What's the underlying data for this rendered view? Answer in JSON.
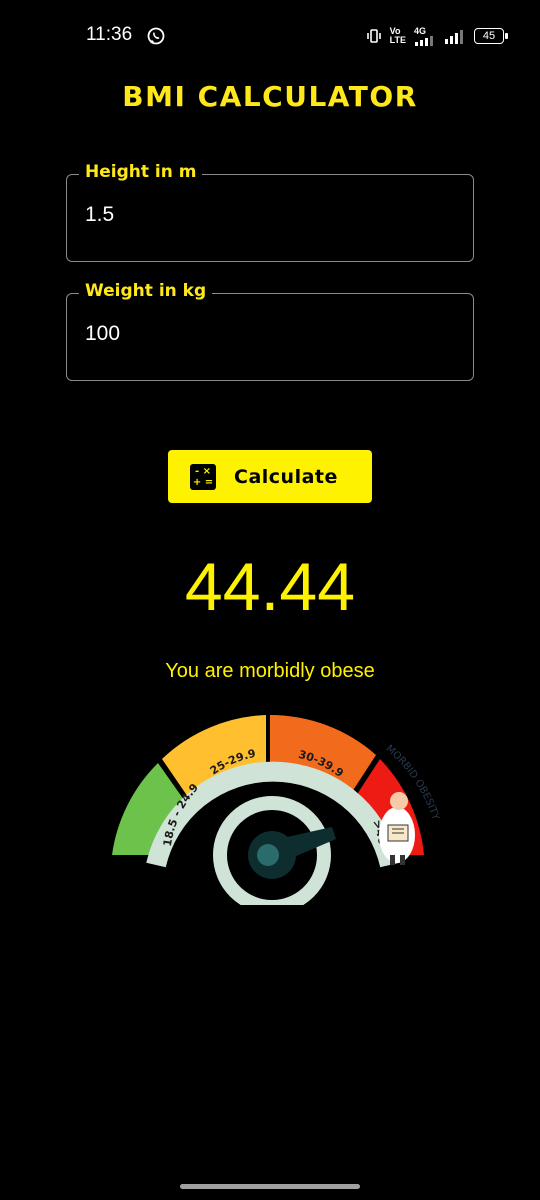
{
  "status_bar": {
    "time": "11:36",
    "network_top": "Vo",
    "network_bottom": "LTE",
    "signal_label": "4G",
    "battery": "45"
  },
  "app": {
    "title": "BMI CALCULATOR"
  },
  "height_field": {
    "label": "Height in m",
    "value": "1.5"
  },
  "weight_field": {
    "label": "Weight in kg",
    "value": "100"
  },
  "calculate_button": {
    "label": "Calculate",
    "icon": "calculator-icon"
  },
  "result": {
    "bmi": "44.44",
    "message": "You are morbidly obese"
  },
  "gauge": {
    "ranges": [
      "18.5 - 24.9",
      "25-29.9",
      "30-39.9",
      ">40"
    ],
    "category_label": "MORBID OBESITY",
    "colors": {
      "normal": "#6cc24a",
      "overweight": "#ffbf2e",
      "obese": "#f26b1d",
      "morbid": "#ee1b15",
      "inner_arc": "#cfe3d6",
      "needle": "#0e2d2f",
      "needle_hub": "#2a6b6c"
    },
    "needle_value": 44.44
  }
}
